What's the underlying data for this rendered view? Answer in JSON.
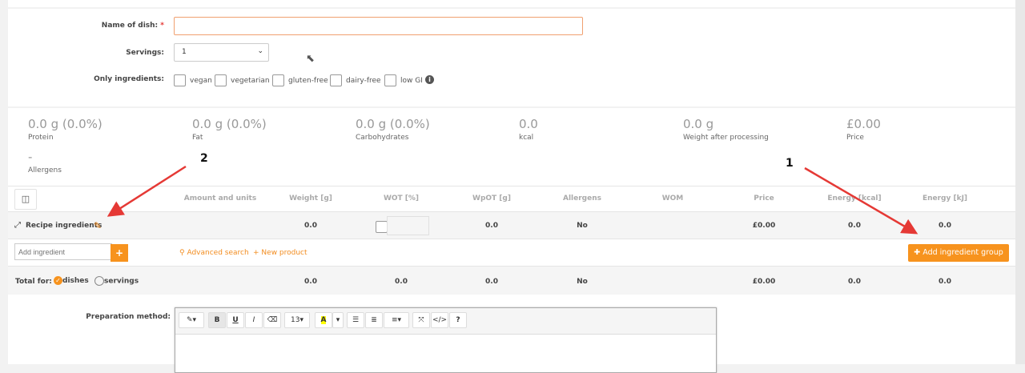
{
  "form": {
    "name_label": "Name of dish:",
    "required_mark": "*",
    "name_value": "",
    "servings_label": "Servings:",
    "servings_value": "1",
    "only_label": "Only ingredients:",
    "options": [
      "vegan",
      "vegetarian",
      "gluten-free",
      "dairy-free",
      "low GI"
    ]
  },
  "summary": [
    {
      "value": "0.0 g (0.0%)",
      "label": "Protein"
    },
    {
      "value": "0.0 g (0.0%)",
      "label": "Fat"
    },
    {
      "value": "0.0 g (0.0%)",
      "label": "Carbohydrates"
    },
    {
      "value": "0.0",
      "label": "kcal"
    },
    {
      "value": "0.0 g",
      "label": "Weight after processing"
    },
    {
      "value": "£0.00",
      "label": "Price"
    }
  ],
  "allergens": {
    "value": "-",
    "label": "Allergens"
  },
  "table": {
    "headers": [
      "Amount and units",
      "Weight [g]",
      "WOT [%]",
      "WpOT [g]",
      "Allergens",
      "WOM",
      "Price",
      "Energy [kcal]",
      "Energy [kJ]"
    ],
    "group": {
      "name": "Recipe ingredients",
      "weight": "0.0",
      "wpot": "0.0",
      "allergens": "No",
      "price": "£0.00",
      "kcal": "0.0",
      "kj": "0.0"
    },
    "add_placeholder": "Add ingredient",
    "add_btn": "+",
    "advanced_search": "Advanced search",
    "new_product": "New product",
    "add_group": "Add ingredient group",
    "total": {
      "label": "Total for:",
      "opt1": "dishes",
      "opt2": "servings",
      "weight": "0.0",
      "wot": "0.0",
      "wpot": "0.0",
      "allergens": "No",
      "price": "£0.00",
      "kcal": "0.0",
      "kj": "0.0"
    }
  },
  "prep": {
    "label": "Preparation method:",
    "font_size": "13",
    "toolbar": [
      "B",
      "U",
      "I",
      "A",
      "?",
      "</>"
    ]
  },
  "annotations": {
    "one": "1",
    "two": "2"
  },
  "colors": {
    "accent": "#f7931e",
    "arrow": "#e53935"
  }
}
